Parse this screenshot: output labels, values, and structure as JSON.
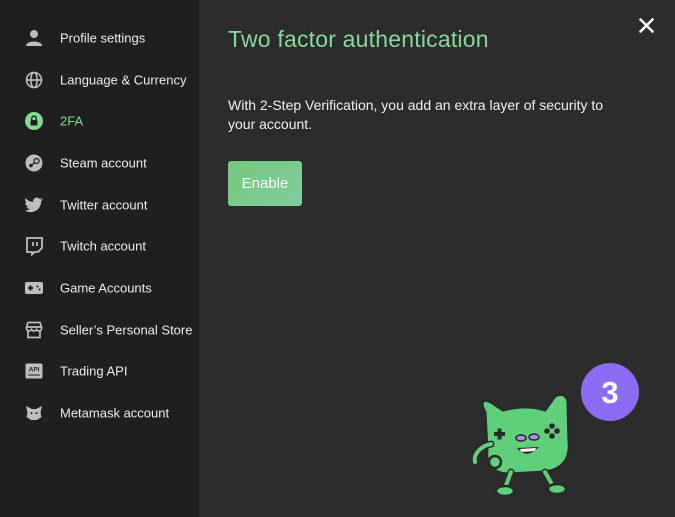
{
  "sidebar": {
    "items": [
      {
        "label": "Profile settings",
        "icon": "user-icon",
        "active": false
      },
      {
        "label": "Language & Currency",
        "icon": "globe-icon",
        "active": false
      },
      {
        "label": "2FA",
        "icon": "lock-icon",
        "active": true
      },
      {
        "label": "Steam account",
        "icon": "steam-icon",
        "active": false
      },
      {
        "label": "Twitter account",
        "icon": "twitter-icon",
        "active": false
      },
      {
        "label": "Twitch account",
        "icon": "twitch-icon",
        "active": false
      },
      {
        "label": "Game Accounts",
        "icon": "gamepad-icon",
        "active": false
      },
      {
        "label": "Seller’s Personal Store",
        "icon": "store-icon",
        "active": false
      },
      {
        "label": "Trading API",
        "icon": "api-icon",
        "active": false
      },
      {
        "label": "Metamask account",
        "icon": "fox-icon",
        "active": false
      }
    ]
  },
  "main": {
    "title": "Two factor authentication",
    "description": "With 2-Step Verification, you add an extra layer of security to your account.",
    "enable_label": "Enable"
  },
  "mascot": {
    "badge": "3"
  },
  "colors": {
    "accent": "#86d99a",
    "sidebar_bg": "#1f1f1f",
    "main_bg": "#2c2c2c",
    "badge": "#8c6cf2"
  }
}
